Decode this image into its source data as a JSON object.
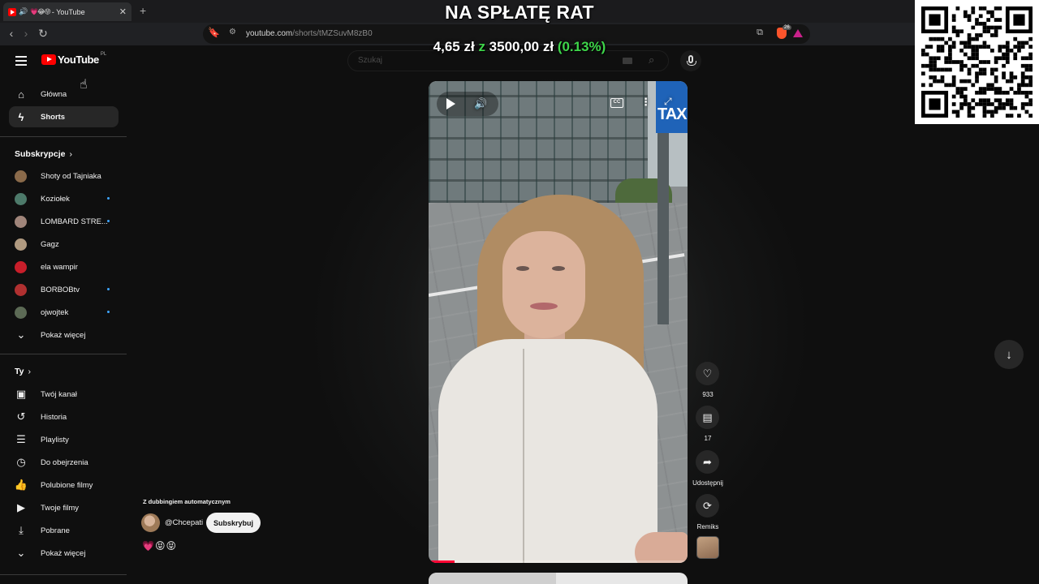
{
  "browser": {
    "tab_title": "- YouTube",
    "tab_emojis": "💗😂😝",
    "new_tab": "+",
    "url_host": "youtube.com",
    "url_path": "/shorts/tMZSuvM8zB0",
    "brave_badge": "26"
  },
  "overlay": {
    "title": "NA SPŁATĘ RAT",
    "amount": "4,65 zł",
    "of": "z",
    "total": "3500,00 zł",
    "percent": "(0.13%)"
  },
  "youtube": {
    "logo_text": "YouTube",
    "country": "PL",
    "search_placeholder": "Szukaj"
  },
  "sidebar": {
    "main": [
      {
        "label": "Główna",
        "icon": "home-icon"
      },
      {
        "label": "Shorts",
        "icon": "shorts-icon",
        "active": true
      }
    ],
    "subs_heading": "Subskrypcje",
    "subs": [
      {
        "label": "Shoty od Tajniaka",
        "color": "#8a6a4a",
        "new": false
      },
      {
        "label": "Koziołek",
        "color": "#4d7a6a",
        "new": true
      },
      {
        "label": "LOMBARD STRE...",
        "color": "#a0857a",
        "new": true
      },
      {
        "label": "Gagz",
        "color": "#b09a80",
        "new": false
      },
      {
        "label": "ela wampir",
        "color": "#c81e2a",
        "new": false
      },
      {
        "label": "BORBOBtv",
        "color": "#b03030",
        "new": true
      },
      {
        "label": "ojwojtek",
        "color": "#5c6a55",
        "new": true
      }
    ],
    "subs_more": "Pokaż więcej",
    "you_heading": "Ty",
    "you": [
      {
        "label": "Twój kanał",
        "icon": "channel-icon"
      },
      {
        "label": "Historia",
        "icon": "history-icon"
      },
      {
        "label": "Playlisty",
        "icon": "playlist-icon"
      },
      {
        "label": "Do obejrzenia",
        "icon": "clock-icon"
      },
      {
        "label": "Polubione filmy",
        "icon": "thumb-up-icon"
      },
      {
        "label": "Twoje filmy",
        "icon": "video-icon"
      },
      {
        "label": "Pobrane",
        "icon": "download-icon"
      }
    ],
    "you_more": "Pokaż więcej"
  },
  "short": {
    "progress": 0.1,
    "cc": "CC",
    "likes": "933",
    "comments": "17",
    "share": "Udostępnij",
    "remix": "Remiks",
    "dub_note": "Z dubbingiem automatycznym",
    "channel": "@Chcepati",
    "subscribe": "Subskrybuj",
    "emojis": "💗😝😝"
  },
  "colors": {
    "accent": "#ff0000",
    "money_green": "#3ed54a",
    "new_dot": "#3ea6ff"
  }
}
